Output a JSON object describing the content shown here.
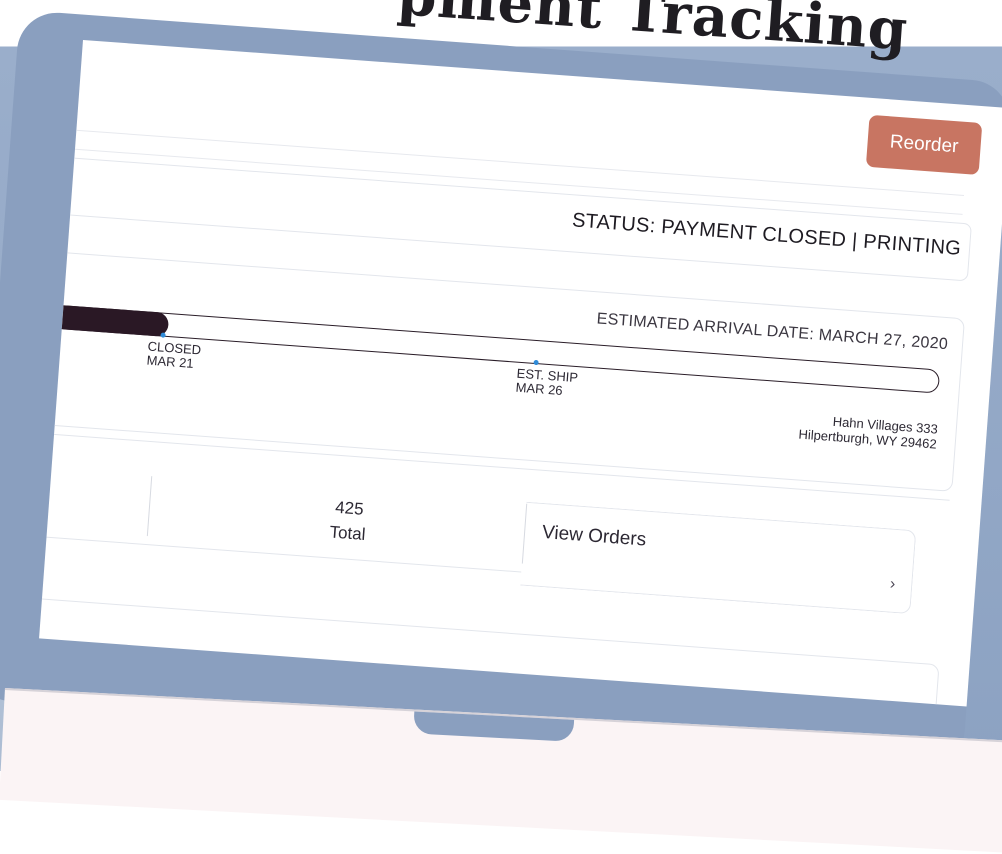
{
  "header": {
    "title": "pment Tracking"
  },
  "toolbar": {
    "reorder_label": "Reorder"
  },
  "status": {
    "text": "STATUS: PAYMENT CLOSED | PRINTING"
  },
  "tracking": {
    "eta": "ESTIMATED ARRIVAL DATE: MARCH 27, 2020",
    "progress_fraction": 0.13,
    "milestones": [
      {
        "label": "CLOSED",
        "date": "MAR 21"
      },
      {
        "label": "EST. SHIP",
        "date": "MAR 26"
      }
    ],
    "address": {
      "line1": "Hahn Villages 333",
      "line2": "Hilpertburgh, WY 29462"
    }
  },
  "summary": {
    "total_value": "425",
    "total_label": "Total",
    "view_orders_label": "View Orders",
    "chevron": "›"
  },
  "icons": {
    "chevron": "chevron-right-icon"
  },
  "colors": {
    "accent": "#c87562",
    "progress": "#2a1825",
    "milestone_dot": "#2f8bd8",
    "frame": "#8a9fbf"
  }
}
